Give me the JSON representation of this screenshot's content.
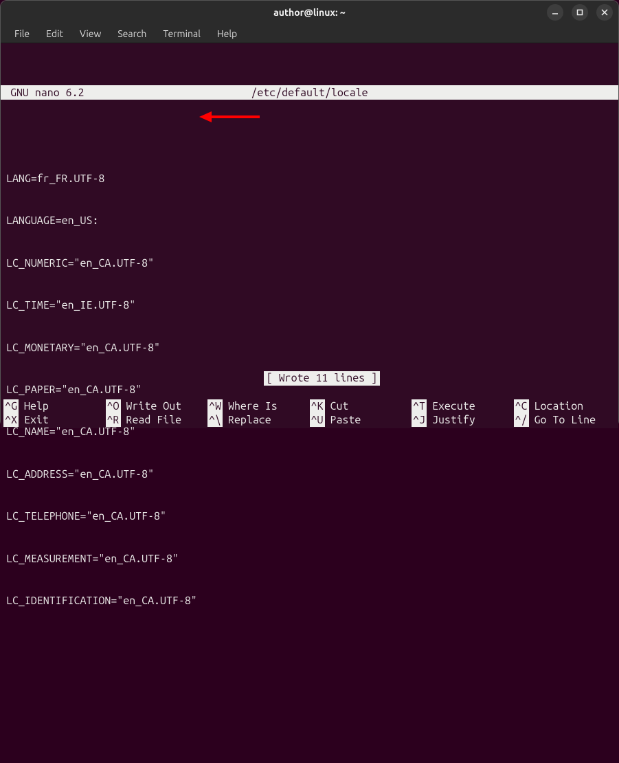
{
  "window": {
    "title": "author@linux: ~"
  },
  "menubar": [
    "File",
    "Edit",
    "View",
    "Search",
    "Terminal",
    "Help"
  ],
  "nano": {
    "app_label": "GNU nano 6.2",
    "filepath": "/etc/default/locale",
    "status": "[ Wrote 11 lines ]"
  },
  "file_lines": [
    "LANG=fr_FR.UTF-8",
    "LANGUAGE=en_US:",
    "LC_NUMERIC=\"en_CA.UTF-8\"",
    "LC_TIME=\"en_IE.UTF-8\"",
    "LC_MONETARY=\"en_CA.UTF-8\"",
    "LC_PAPER=\"en_CA.UTF-8\"",
    "LC_NAME=\"en_CA.UTF-8\"",
    "LC_ADDRESS=\"en_CA.UTF-8\"",
    "LC_TELEPHONE=\"en_CA.UTF-8\"",
    "LC_MEASUREMENT=\"en_CA.UTF-8\"",
    "LC_IDENTIFICATION=\"en_CA.UTF-8\""
  ],
  "shortcuts_row1": [
    {
      "key": "^G",
      "label": "Help"
    },
    {
      "key": "^O",
      "label": "Write Out"
    },
    {
      "key": "^W",
      "label": "Where Is"
    },
    {
      "key": "^K",
      "label": "Cut"
    },
    {
      "key": "^T",
      "label": "Execute"
    },
    {
      "key": "^C",
      "label": "Location"
    }
  ],
  "shortcuts_row2": [
    {
      "key": "^X",
      "label": "Exit"
    },
    {
      "key": "^R",
      "label": "Read File"
    },
    {
      "key": "^\\",
      "label": "Replace"
    },
    {
      "key": "^U",
      "label": "Paste"
    },
    {
      "key": "^J",
      "label": "Justify"
    },
    {
      "key": "^/",
      "label": "Go To Line"
    }
  ],
  "annotation": {
    "arrow_color": "#ff0000"
  }
}
